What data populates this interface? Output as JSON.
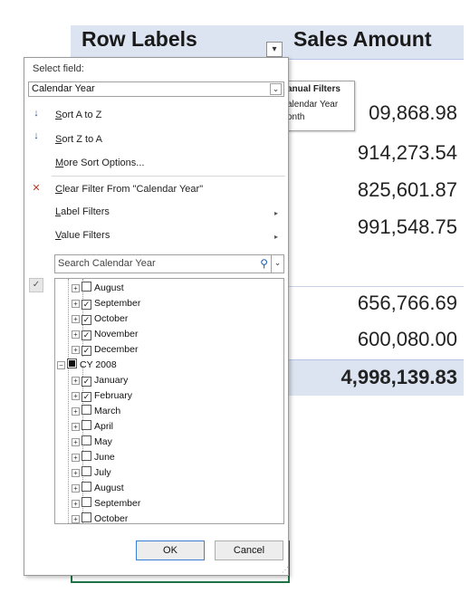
{
  "pivot": {
    "header_row_labels": "Row Labels",
    "header_sales_amount": "Sales Amount",
    "filter_button_icon": "filter-dropdown-icon",
    "values": [
      "09,868.98",
      "914,273.54",
      "825,601.87",
      "991,548.75",
      "656,766.69",
      "600,080.00"
    ],
    "total": "4,998,139.83"
  },
  "submenu": {
    "items": [
      "anual Filters",
      "alendar Year",
      "onth"
    ]
  },
  "dropdown": {
    "select_field_label": "Select field:",
    "field_value": "Calendar Year",
    "sort_az": "Sort A to Z",
    "sort_za": "Sort Z to A",
    "more_sort": "More Sort Options...",
    "clear_filter": "Clear Filter From \"Calendar Year\"",
    "label_filters": "Label Filters",
    "value_filters": "Value Filters",
    "search_placeholder": "Search Calendar Year",
    "tree": [
      {
        "label": "August",
        "checked": false,
        "level": 2
      },
      {
        "label": "September",
        "checked": true,
        "level": 2
      },
      {
        "label": "October",
        "checked": true,
        "level": 2
      },
      {
        "label": "November",
        "checked": true,
        "level": 2
      },
      {
        "label": "December",
        "checked": true,
        "level": 2
      },
      {
        "label": "CY 2008",
        "checked": "partial",
        "level": 1
      },
      {
        "label": "January",
        "checked": true,
        "level": 2
      },
      {
        "label": "February",
        "checked": true,
        "level": 2
      },
      {
        "label": "March",
        "checked": false,
        "level": 2
      },
      {
        "label": "April",
        "checked": false,
        "level": 2
      },
      {
        "label": "May",
        "checked": false,
        "level": 2
      },
      {
        "label": "June",
        "checked": false,
        "level": 2
      },
      {
        "label": "July",
        "checked": false,
        "level": 2
      },
      {
        "label": "August",
        "checked": false,
        "level": 2
      },
      {
        "label": "September",
        "checked": false,
        "level": 2
      },
      {
        "label": "October",
        "checked": false,
        "level": 2
      }
    ],
    "ok_label": "OK",
    "cancel_label": "Cancel"
  },
  "colors": {
    "header_fill": "#dce4f2",
    "selection_border": "#217346",
    "search_icon": "#1e5fb4"
  }
}
